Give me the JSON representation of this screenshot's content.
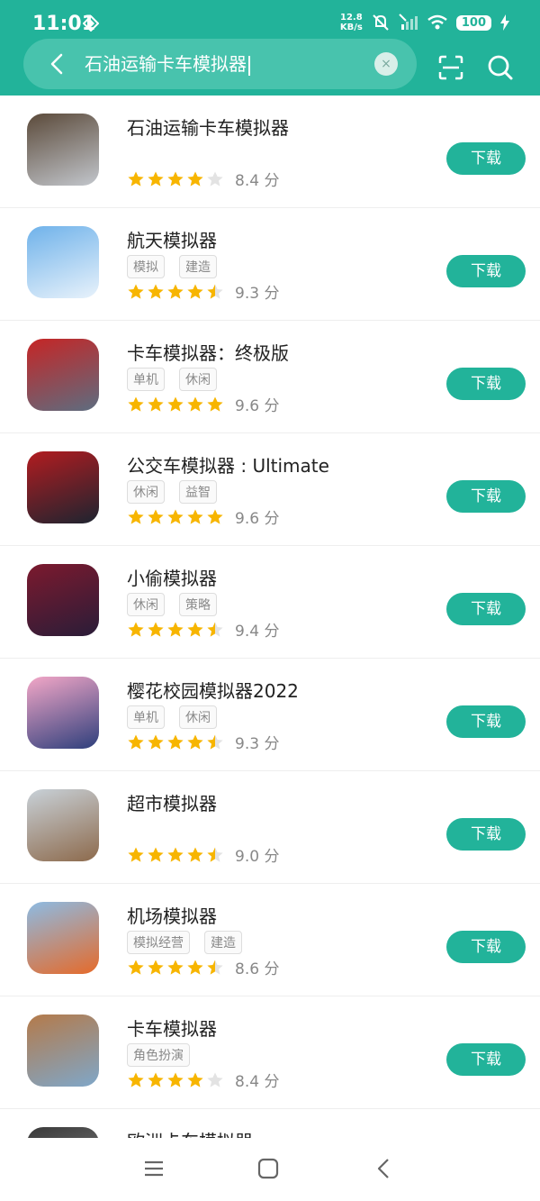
{
  "status_bar": {
    "time": "11:01",
    "net_speed_value": "12.8",
    "net_speed_unit": "KB/s",
    "battery": "100"
  },
  "search": {
    "query": "石油运输卡车模拟器",
    "clear_label": "×"
  },
  "download_label": "下载",
  "score_unit": "分",
  "apps": [
    {
      "name": "石油运输卡车模拟器",
      "tags": [],
      "stars": 4,
      "score": "8.4",
      "icon_colors": [
        "#5b4a3a",
        "#c2c6cc"
      ]
    },
    {
      "name": "航天模拟器",
      "tags": [
        "模拟",
        "建造"
      ],
      "stars": 4.5,
      "score": "9.3",
      "icon_colors": [
        "#6fb2ea",
        "#e8f2fb"
      ]
    },
    {
      "name": "卡车模拟器：终极版",
      "tags": [
        "单机",
        "休闲"
      ],
      "stars": 5,
      "score": "9.6",
      "icon_colors": [
        "#c62525",
        "#5d6d80"
      ]
    },
    {
      "name": "公交车模拟器 : Ultimate",
      "tags": [
        "休闲",
        "益智"
      ],
      "stars": 5,
      "score": "9.6",
      "icon_colors": [
        "#b21c20",
        "#1d2430"
      ]
    },
    {
      "name": "小偷模拟器",
      "tags": [
        "休闲",
        "策略"
      ],
      "stars": 4.5,
      "score": "9.4",
      "icon_colors": [
        "#7c1a2e",
        "#2a1c38"
      ]
    },
    {
      "name": "樱花校园模拟器2022",
      "tags": [
        "单机",
        "休闲"
      ],
      "stars": 4.5,
      "score": "9.3",
      "icon_colors": [
        "#f3a7c7",
        "#2e3f7c"
      ]
    },
    {
      "name": "超市模拟器",
      "tags": [],
      "stars": 4.5,
      "score": "9.0",
      "icon_colors": [
        "#c8d1d8",
        "#8d6a4c"
      ]
    },
    {
      "name": "机场模拟器",
      "tags": [
        "模拟经营",
        "建造"
      ],
      "stars": 4.5,
      "score": "8.6",
      "icon_colors": [
        "#8dbbe3",
        "#e56a2a"
      ]
    },
    {
      "name": "卡车模拟器",
      "tags": [
        "角色扮演"
      ],
      "stars": 4,
      "score": "8.4",
      "icon_colors": [
        "#b47a4a",
        "#7fa7c9"
      ]
    },
    {
      "name": "欧洲卡车模拟器",
      "tags": [],
      "stars": 0,
      "score": "",
      "icon_colors": [
        "#3a3a3a",
        "#8a8a8a"
      ]
    }
  ],
  "colors": {
    "accent": "#22b39a",
    "star_filled": "#f7b500",
    "star_empty": "#e3e3e3"
  },
  "icons": {
    "back": "chevron-left-icon",
    "scan": "scan-icon",
    "search": "search-icon",
    "nav_menu": "menu-icon",
    "nav_home": "square-home-icon",
    "nav_back": "back-triangle-icon"
  }
}
